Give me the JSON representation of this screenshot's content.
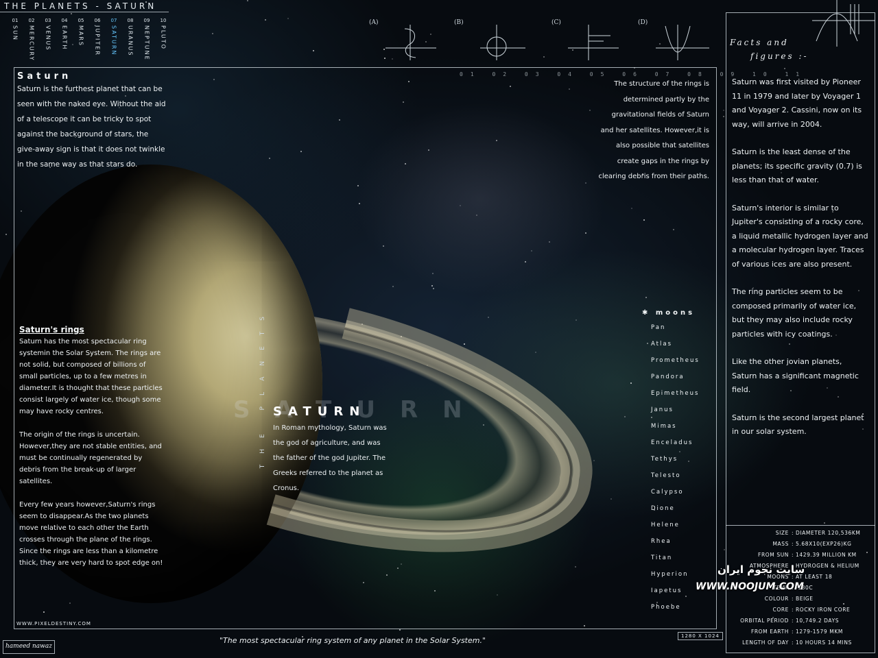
{
  "header": {
    "title": "THE PLANETS - SATURN"
  },
  "nav": [
    {
      "num": "01",
      "name": "SUN"
    },
    {
      "num": "02",
      "name": "MERCURY"
    },
    {
      "num": "03",
      "name": "VENUS"
    },
    {
      "num": "04",
      "name": "EARTH"
    },
    {
      "num": "05",
      "name": "MARS"
    },
    {
      "num": "06",
      "name": "JUPITER"
    },
    {
      "num": "07",
      "name": "SATURN",
      "active": true
    },
    {
      "num": "08",
      "name": "URANUS"
    },
    {
      "num": "09",
      "name": "NEPTUNE"
    },
    {
      "num": "10",
      "name": "PLUTO"
    }
  ],
  "diagrams": [
    "(A)",
    "(B)",
    "(C)",
    "(D)"
  ],
  "intro": {
    "heading": "Saturn",
    "text": "Saturn is the furthest planet that can be seen with the naked eye. Without the aid of a telescope it can be tricky to spot against the background of stars, the give-away sign is that it does not twinkle in the same way as that stars do."
  },
  "rings": {
    "heading": "Saturn's rings",
    "paragraphs": [
      "Saturn has the most spectacular ring systemin the Solar System. The rings are not solid, but composed of billions of small particles, up to a few metres in diameter.It is thought that these particles consist largely of water ice, though some may have rocky centres.",
      "The origin of the rings is uncertain. However,they are not stable entities, and must be continually regenerated by debris from the break-up of larger satellites.",
      "Every few years however,Saturn's rings seem to disappear.As the two planets move relative to each other the Earth crosses through the plane of the rings. Since the rings are less than a kilometre thick, they are very hard to spot edge on!"
    ]
  },
  "center": {
    "big_word": "SATURN",
    "title": "SATURN",
    "vertical": "THE PLANETS",
    "myth": "In Roman mythology, Saturn was the god of agriculture, and was the father of the god Jupiter. The Greeks referred to the planet as Cronus."
  },
  "structure": {
    "text": "The structure of the rings is determined partly by the gravitational fields of Saturn and her satellites. However,it is also possible that satellites create gaps in the rings by clearing debris from their paths."
  },
  "grid_header": "01 02 03 04 05 06 07 08 09 10 11",
  "moons": {
    "title": "moons",
    "list": [
      "Pan",
      "Atlas",
      "Prometheus",
      "Pandora",
      "Epimetheus",
      "Janus",
      "Mimas",
      "Enceladus",
      "Tethys",
      "Telesto",
      "Calypso",
      "Dione",
      "Helene",
      "Rhea",
      "Titan",
      "Hyperion",
      "Iapetus",
      "Phoebe"
    ]
  },
  "facts": {
    "title_line1": "Facts and",
    "title_line2": "figures :-",
    "paragraphs": [
      "Saturn was first visited by Pioneer 11 in 1979 and later by Voyager 1 and Voyager 2. Cassini, now on its way, will arrive in 2004.",
      "Saturn is the least dense of the planets; its specific gravity (0.7) is less than that of water.",
      "Saturn's interior is similar to Jupiter's consisting of a rocky core, a liquid metallic hydrogen layer and a molecular hydrogen layer. Traces of various ices are also present.",
      "The ring particles seem to be composed primarily of water ice, but they may also include rocky particles with icy coatings.",
      "Like the other jovian planets, Saturn has a significant magnetic field.",
      "Saturn is the second largest planet in our solar system."
    ]
  },
  "stats": [
    {
      "key": "SIZE",
      "value": "DIAMETER 120,536KM"
    },
    {
      "key": "MASS",
      "value": "5.68X10(EXP26)KG"
    },
    {
      "key": "FROM SUN",
      "value": "1429.39 MILLION KM"
    },
    {
      "key": "ATMOSPHERE",
      "value": "HYDROGEN & HELIUM"
    },
    {
      "key": "MOONS",
      "value": "AT LEAST 18"
    },
    {
      "key": "TEMP",
      "value": "-180C"
    },
    {
      "key": "COLOUR",
      "value": "BEIGE"
    },
    {
      "key": "CORE",
      "value": "ROCKY IRON CORE"
    },
    {
      "key": "ORBITAL PERIOD",
      "value": "10,749.2 DAYS"
    },
    {
      "key": "FROM EARTH",
      "value": "1279-1579 MKM"
    },
    {
      "key": "LENGTH OF DAY",
      "value": "10 HOURS 14 MINS"
    }
  ],
  "watermark": {
    "fa": "سایت نجوم ایران",
    "en": "WWW.NOOJUM.COM"
  },
  "footer": {
    "site": "WWW.PIXELDESTINY.COM",
    "resolution": "1280 X 1024",
    "quote": "\"The most spectacular ring system of any planet in the Solar System.\"",
    "author": "hameed nawaz"
  }
}
